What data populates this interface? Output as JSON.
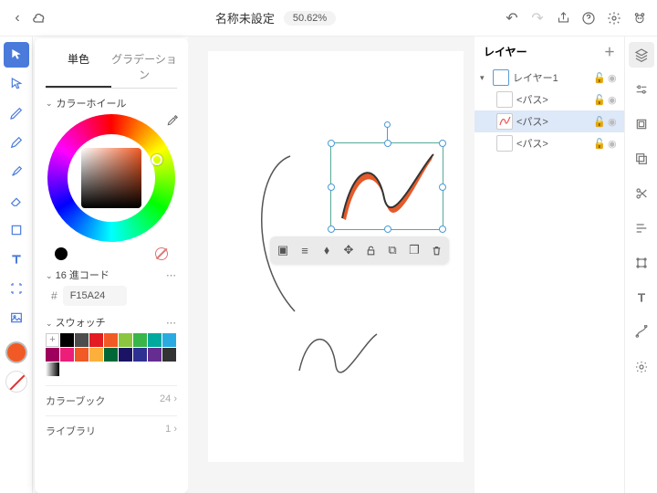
{
  "header": {
    "title": "名称未設定",
    "zoom": "50.62%"
  },
  "colorPanel": {
    "tab_solid": "単色",
    "tab_gradient": "グラデーション",
    "wheel_label": "カラーホイール",
    "hex_label": "16 進コード",
    "hex_value": "F15A24",
    "swatch_label": "スウォッチ",
    "colorbook_label": "カラーブック",
    "colorbook_count": "24 ›",
    "library_label": "ライブラリ",
    "library_count": "1 ›"
  },
  "layers": {
    "title": "レイヤー",
    "layer1": "レイヤー1",
    "path": "<パス>"
  },
  "swatches": [
    "#000000",
    "#4d4d4d",
    "#e31b23",
    "#f15a24",
    "#8cc63f",
    "#39b54a",
    "#00a99d",
    "#29abe2",
    "#9e005d",
    "#ed1e79",
    "#f15a24",
    "#fbb03b",
    "#006837",
    "#1b1464",
    "#2e3192",
    "#662d91",
    "#333333"
  ]
}
